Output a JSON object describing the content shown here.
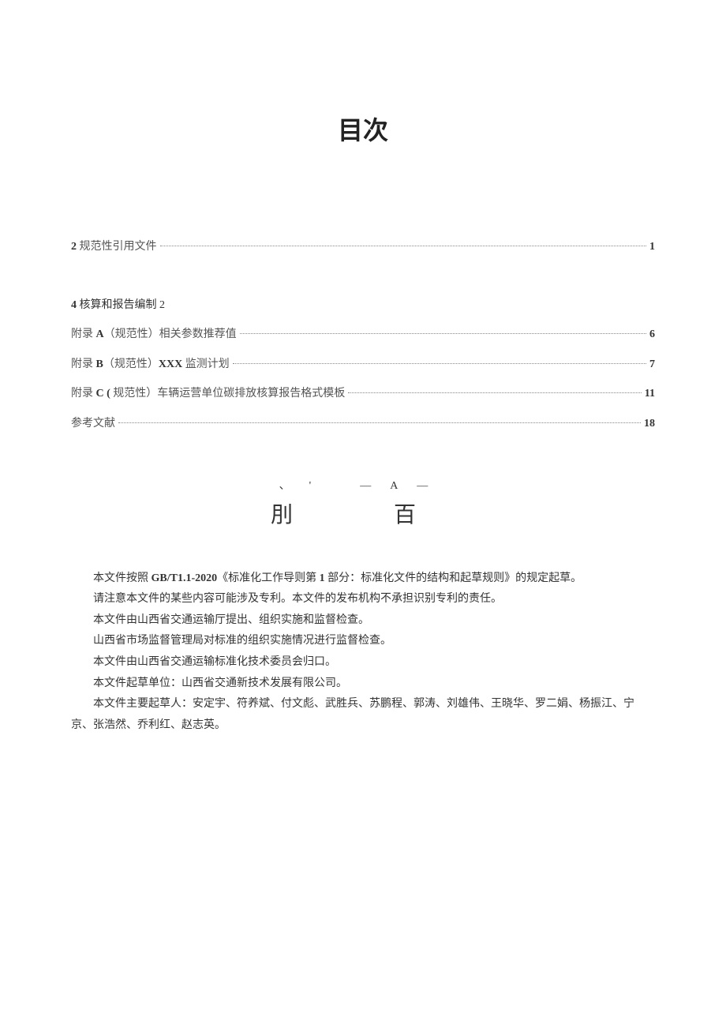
{
  "title": "目次",
  "toc": {
    "item1": {
      "label_bold": "2",
      "label_rest": " 规范性引用文件",
      "page": "1"
    },
    "item2": {
      "label_bold": "4",
      "label_rest": " 核算和报告编制 2"
    },
    "item3": {
      "label_pre": "附录 ",
      "label_bold": "A",
      "label_rest": "（规范性）相关参数推荐值",
      "page": "6"
    },
    "item4": {
      "label_pre": "附录 ",
      "label_bold": "B",
      "label_mid": "（规范性）",
      "label_bold2": "XXX",
      "label_rest": " 监测计划 ",
      "page": "7"
    },
    "item5": {
      "label_pre": "附录 ",
      "label_bold": "C (",
      "label_rest": " 规范性）车辆运营单位碳排放核算报告格式模板 ",
      "page": "11"
    },
    "item6": {
      "label": "参考文献",
      "page": "18"
    }
  },
  "subtitle": {
    "top": "、'　—A—",
    "bottom": "刖　百"
  },
  "body": {
    "p1_a": "本文件按照 ",
    "p1_b": "GB/T1.1-2020",
    "p1_c": "《标准化工作导则第 ",
    "p1_d": "1",
    "p1_e": " 部分：标准化文件的结构和起草规则》的规定起草。",
    "p2": "请注意本文件的某些内容可能涉及专利。本文件的发布机构不承担识别专利的责任。",
    "p3": "本文件由山西省交通运输厅提出、组织实施和监督检查。",
    "p4": "山西省市场监督管理局对标准的组织实施情况进行监督检查。",
    "p5": "本文件由山西省交通运输标准化技术委员会归口。",
    "p6": "本文件起草单位：山西省交通新技术发展有限公司。",
    "p7": "本文件主要起草人：安定宇、符养斌、付文彪、武胜兵、苏鹏程、郭涛、刘雄伟、王晓华、罗二娟、杨振江、宁",
    "p8": "京、张浩然、乔利红、赵志英。"
  }
}
